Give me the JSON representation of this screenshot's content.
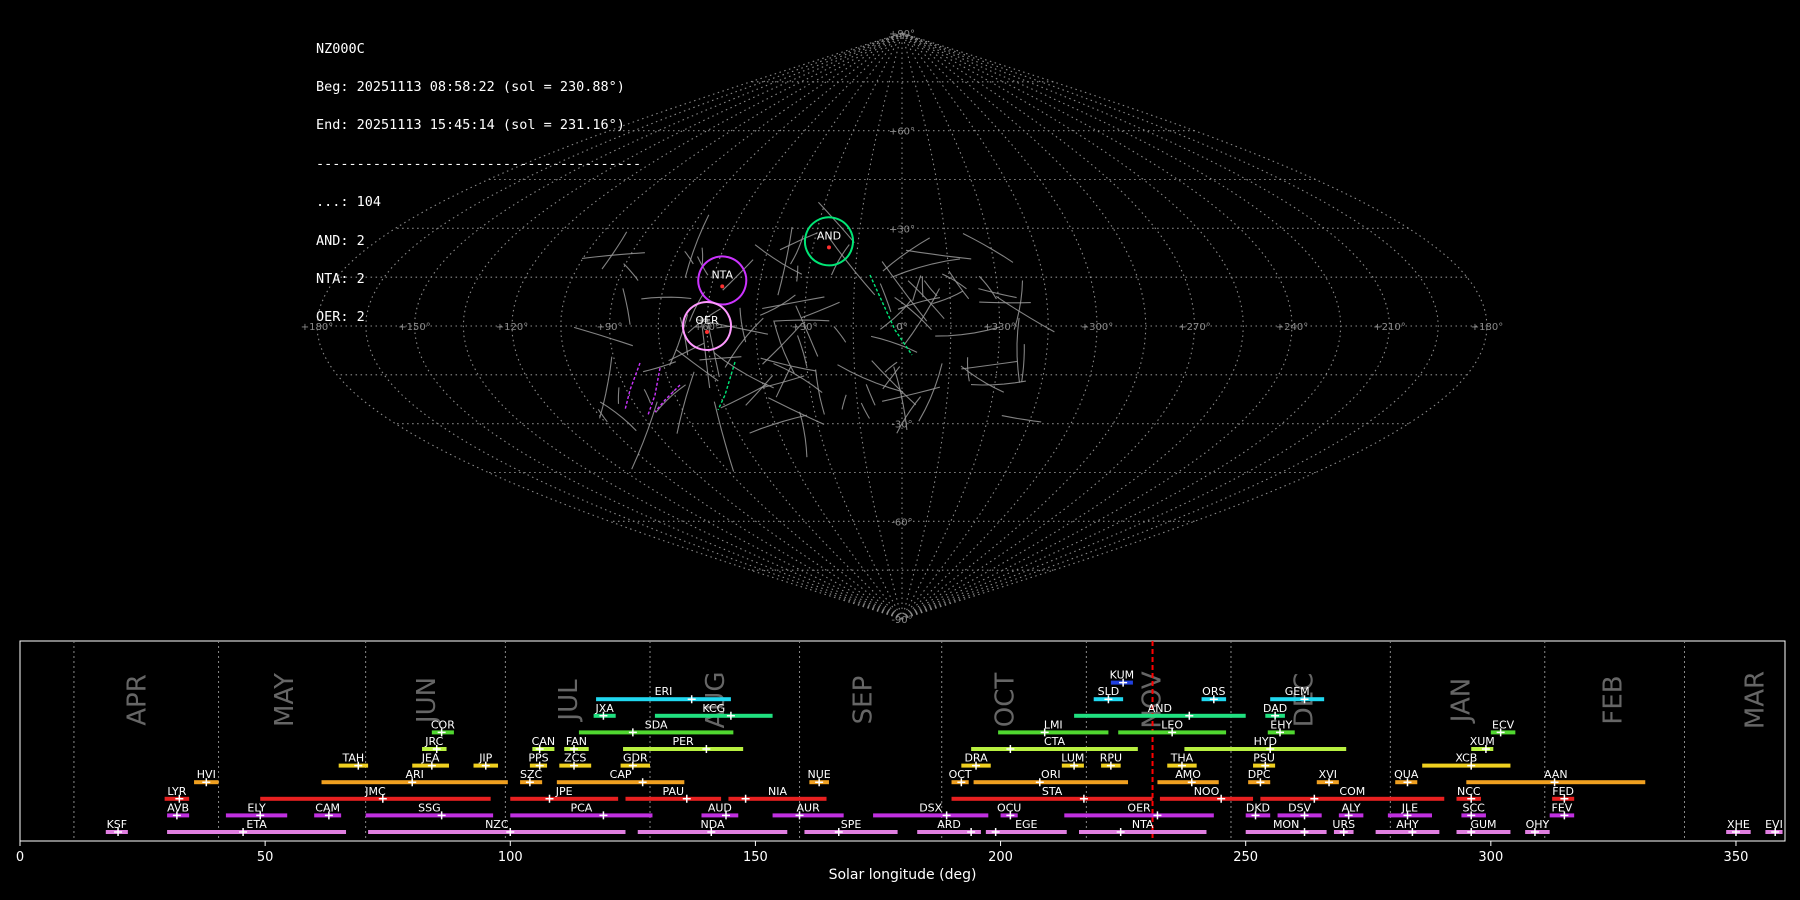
{
  "header": {
    "lines": [
      "NZ000C",
      "Beg: 20251113 08:58:22 (sol = 230.88°)",
      "End: 20251113 15:45:14 (sol = 231.16°)",
      "----------------------------------------",
      "...: 104",
      "AND: 2",
      "NTA: 2",
      "OER: 2"
    ]
  },
  "colors": {
    "background": "#000000",
    "grid": "#8a8a8a",
    "meteor": "#9a9a9a",
    "current_sol": "#ff0000"
  },
  "chart_data": [
    {
      "type": "scatter",
      "projection": "sinusoidal-sky",
      "lon_ticks": [
        "+180°",
        "+150°",
        "+120°",
        "+90°",
        "+60°",
        "+30°",
        "0°",
        "+330°",
        "+300°",
        "+270°",
        "+240°",
        "+210°",
        "+180°"
      ],
      "lat_ticks": [
        "+90°",
        "+60°",
        "+30°",
        "0°",
        "-30°",
        "-60°",
        "-90°"
      ],
      "radiants": [
        {
          "code": "NTA",
          "ra": 57,
          "dec": 14,
          "color": "#cc33ff"
        },
        {
          "code": "AND",
          "ra": 25,
          "dec": 26,
          "color": "#00e676"
        },
        {
          "code": "OER",
          "ra": 60,
          "dec": 0,
          "color": "#ff99ff"
        }
      ]
    },
    {
      "type": "bar",
      "xlabel": "Solar longitude (deg)",
      "xlim": [
        0,
        360
      ],
      "x_ticks": [
        0,
        50,
        100,
        150,
        200,
        250,
        300,
        350
      ],
      "current_sol": 231.0,
      "month_boundaries": [
        11,
        40.5,
        70.5,
        99,
        128.5,
        159,
        188,
        217.5,
        247,
        279.5,
        311,
        339.5
      ],
      "months": [
        {
          "label": "APR",
          "sol": 24
        },
        {
          "label": "MAY",
          "sol": 54
        },
        {
          "label": "JUN",
          "sol": 83
        },
        {
          "label": "JUL",
          "sol": 112
        },
        {
          "label": "AUG",
          "sol": 142
        },
        {
          "label": "SEP",
          "sol": 172
        },
        {
          "label": "OCT",
          "sol": 201
        },
        {
          "label": "NOV",
          "sol": 231
        },
        {
          "label": "DEC",
          "sol": 262
        },
        {
          "label": "JAN",
          "sol": 294
        },
        {
          "label": "FEB",
          "sol": 325
        },
        {
          "label": "MAR",
          "sol": 354
        }
      ],
      "showers": [
        {
          "code": "KSF",
          "start": 17.5,
          "end": 22,
          "peak": 20,
          "row": 0,
          "color": "#e07ee0"
        },
        {
          "code": "ETA",
          "start": 30,
          "end": 66.5,
          "peak": 45.5,
          "row": 0,
          "color": "#e07ee0"
        },
        {
          "code": "NZC",
          "start": 71,
          "end": 123.5,
          "peak": 100,
          "row": 0,
          "color": "#e07ee0"
        },
        {
          "code": "NDA",
          "start": 126,
          "end": 156.5,
          "peak": 141,
          "row": 0,
          "color": "#e07ee0"
        },
        {
          "code": "SPE",
          "start": 160,
          "end": 179,
          "peak": 167,
          "row": 0,
          "color": "#e07ee0"
        },
        {
          "code": "ARD",
          "start": 183,
          "end": 196,
          "peak": 194,
          "row": 0,
          "color": "#e07ee0"
        },
        {
          "code": "EGE",
          "start": 197,
          "end": 213.5,
          "peak": 199,
          "row": 0,
          "color": "#e07ee0"
        },
        {
          "code": "NTA",
          "start": 216,
          "end": 242,
          "peak": 224.5,
          "row": 0,
          "color": "#e07ee0"
        },
        {
          "code": "MON",
          "start": 250,
          "end": 266.5,
          "peak": 262,
          "row": 0,
          "color": "#e07ee0"
        },
        {
          "code": "URS",
          "start": 268,
          "end": 272,
          "peak": 270,
          "row": 0,
          "color": "#e07ee0"
        },
        {
          "code": "AHY",
          "start": 276.5,
          "end": 289.5,
          "peak": 284,
          "row": 0,
          "color": "#e07ee0"
        },
        {
          "code": "GUM",
          "start": 293,
          "end": 304,
          "peak": 296,
          "row": 0,
          "color": "#e07ee0"
        },
        {
          "code": "OHY",
          "start": 307,
          "end": 312,
          "peak": 309,
          "row": 0,
          "color": "#e07ee0"
        },
        {
          "code": "XHE",
          "start": 348,
          "end": 353,
          "peak": 350,
          "row": 0,
          "color": "#e07ee0"
        },
        {
          "code": "EVI",
          "start": 356,
          "end": 359.5,
          "peak": 358,
          "row": 0,
          "color": "#e07ee0"
        },
        {
          "code": "AVB",
          "start": 30,
          "end": 34.5,
          "peak": 32,
          "row": 1,
          "color": "#c030e0"
        },
        {
          "code": "ELY",
          "start": 42,
          "end": 54.5,
          "peak": 49,
          "row": 1,
          "color": "#c030e0"
        },
        {
          "code": "CAM",
          "start": 60,
          "end": 65.5,
          "peak": 63,
          "row": 1,
          "color": "#c030e0"
        },
        {
          "code": "SSG",
          "start": 70.5,
          "end": 96.5,
          "peak": 86,
          "row": 1,
          "color": "#c030e0"
        },
        {
          "code": "PCA",
          "start": 100,
          "end": 129,
          "peak": 119,
          "row": 1,
          "color": "#c030e0"
        },
        {
          "code": "AUD",
          "start": 139,
          "end": 146.5,
          "peak": 144,
          "row": 1,
          "color": "#c030e0"
        },
        {
          "code": "AUR",
          "start": 153.5,
          "end": 168,
          "peak": 159,
          "row": 1,
          "color": "#c030e0"
        },
        {
          "code": "DSX",
          "start": 174,
          "end": 197.5,
          "peak": 189,
          "row": 1,
          "color": "#c030e0"
        },
        {
          "code": "OCU",
          "start": 200,
          "end": 203.5,
          "peak": 202,
          "row": 1,
          "color": "#c030e0"
        },
        {
          "code": "OER",
          "start": 213,
          "end": 243.5,
          "peak": 232,
          "row": 1,
          "color": "#c030e0"
        },
        {
          "code": "DKD",
          "start": 250,
          "end": 255,
          "peak": 252,
          "row": 1,
          "color": "#c030e0"
        },
        {
          "code": "DSV",
          "start": 256.5,
          "end": 265.5,
          "peak": 262,
          "row": 1,
          "color": "#c030e0"
        },
        {
          "code": "ALY",
          "start": 269,
          "end": 274,
          "peak": 271,
          "row": 1,
          "color": "#c030e0"
        },
        {
          "code": "JLE",
          "start": 279,
          "end": 288,
          "peak": 283,
          "row": 1,
          "color": "#c030e0"
        },
        {
          "code": "SCC",
          "start": 294,
          "end": 299,
          "peak": 296,
          "row": 1,
          "color": "#c030e0"
        },
        {
          "code": "FEV",
          "start": 312,
          "end": 317,
          "peak": 315,
          "row": 1,
          "color": "#c030e0"
        },
        {
          "code": "LYR",
          "start": 29.5,
          "end": 34.5,
          "peak": 32.5,
          "row": 2,
          "color": "#e82020"
        },
        {
          "code": "JMC",
          "start": 49,
          "end": 96,
          "peak": 74,
          "row": 2,
          "color": "#e82020"
        },
        {
          "code": "JPE",
          "start": 100,
          "end": 122,
          "peak": 108,
          "row": 2,
          "color": "#e82020"
        },
        {
          "code": "PAU",
          "start": 123.5,
          "end": 143,
          "peak": 136,
          "row": 2,
          "color": "#e82020"
        },
        {
          "code": "NIA",
          "start": 144.5,
          "end": 164.5,
          "peak": 148,
          "row": 2,
          "color": "#e82020"
        },
        {
          "code": "STA",
          "start": 190,
          "end": 231,
          "peak": 217,
          "row": 2,
          "color": "#e82020"
        },
        {
          "code": "NOO",
          "start": 232.5,
          "end": 251.5,
          "peak": 245,
          "row": 2,
          "color": "#e82020"
        },
        {
          "code": "COM",
          "start": 253,
          "end": 290.5,
          "peak": 264,
          "row": 2,
          "color": "#e82020"
        },
        {
          "code": "NCC",
          "start": 293,
          "end": 298,
          "peak": 296,
          "row": 2,
          "color": "#e82020"
        },
        {
          "code": "FED",
          "start": 312.5,
          "end": 317,
          "peak": 315,
          "row": 2,
          "color": "#e82020"
        },
        {
          "code": "HVI",
          "start": 35.5,
          "end": 40.5,
          "peak": 38,
          "row": 3,
          "color": "#f0a020"
        },
        {
          "code": "ARI",
          "start": 61.5,
          "end": 99.5,
          "peak": 80,
          "row": 3,
          "color": "#f0a020"
        },
        {
          "code": "SZC",
          "start": 102,
          "end": 106.5,
          "peak": 104,
          "row": 3,
          "color": "#f0a020"
        },
        {
          "code": "CAP",
          "start": 109.5,
          "end": 135.5,
          "peak": 127,
          "row": 3,
          "color": "#f0a020"
        },
        {
          "code": "NUE",
          "start": 161,
          "end": 165,
          "peak": 163,
          "row": 3,
          "color": "#f0a020"
        },
        {
          "code": "OCT",
          "start": 190,
          "end": 193.5,
          "peak": 192,
          "row": 3,
          "color": "#f0a020"
        },
        {
          "code": "ORI",
          "start": 194.5,
          "end": 226,
          "peak": 208,
          "row": 3,
          "color": "#f0a020"
        },
        {
          "code": "AMO",
          "start": 232,
          "end": 244.5,
          "peak": 239,
          "row": 3,
          "color": "#f0a020"
        },
        {
          "code": "DPC",
          "start": 250.5,
          "end": 255,
          "peak": 253,
          "row": 3,
          "color": "#f0a020"
        },
        {
          "code": "XVI",
          "start": 264.5,
          "end": 269,
          "peak": 267,
          "row": 3,
          "color": "#f0a020"
        },
        {
          "code": "QUA",
          "start": 280.5,
          "end": 285,
          "peak": 283,
          "row": 3,
          "color": "#f0a020"
        },
        {
          "code": "AAN",
          "start": 295,
          "end": 331.5,
          "peak": 313,
          "row": 3,
          "color": "#f0a020"
        },
        {
          "code": "TAH",
          "start": 65,
          "end": 71,
          "peak": 69,
          "row": 4,
          "color": "#f0d020"
        },
        {
          "code": "JEA",
          "start": 80,
          "end": 87.5,
          "peak": 84,
          "row": 4,
          "color": "#f0d020"
        },
        {
          "code": "JIP",
          "start": 92.5,
          "end": 97.5,
          "peak": 95,
          "row": 4,
          "color": "#f0d020"
        },
        {
          "code": "PPS",
          "start": 104,
          "end": 107.5,
          "peak": 106,
          "row": 4,
          "color": "#f0d020"
        },
        {
          "code": "ZCS",
          "start": 110,
          "end": 116.5,
          "peak": 113,
          "row": 4,
          "color": "#f0d020"
        },
        {
          "code": "GDR",
          "start": 122.5,
          "end": 128.5,
          "peak": 125,
          "row": 4,
          "color": "#f0d020"
        },
        {
          "code": "DRA",
          "start": 192,
          "end": 198,
          "peak": 195,
          "row": 4,
          "color": "#f0d020"
        },
        {
          "code": "LUM",
          "start": 212.5,
          "end": 217,
          "peak": 215,
          "row": 4,
          "color": "#f0d020"
        },
        {
          "code": "RPU",
          "start": 220.5,
          "end": 224.5,
          "peak": 222.5,
          "row": 4,
          "color": "#f0d020"
        },
        {
          "code": "THA",
          "start": 234,
          "end": 240,
          "peak": 237,
          "row": 4,
          "color": "#f0d020"
        },
        {
          "code": "PSU",
          "start": 251.5,
          "end": 256,
          "peak": 254,
          "row": 4,
          "color": "#f0d020"
        },
        {
          "code": "XCB",
          "start": 286,
          "end": 304,
          "peak": 296,
          "row": 4,
          "color": "#f0d020"
        },
        {
          "code": "JRC",
          "start": 82,
          "end": 87,
          "peak": 85,
          "row": 5,
          "color": "#b8f040"
        },
        {
          "code": "CAN",
          "start": 104.5,
          "end": 109,
          "peak": 106,
          "row": 5,
          "color": "#b8f040"
        },
        {
          "code": "FAN",
          "start": 111,
          "end": 116,
          "peak": 113,
          "row": 5,
          "color": "#b8f040"
        },
        {
          "code": "PER",
          "start": 123,
          "end": 147.5,
          "peak": 140,
          "row": 5,
          "color": "#b8f040"
        },
        {
          "code": "CTA",
          "start": 194,
          "end": 228,
          "peak": 202,
          "row": 5,
          "color": "#b8f040"
        },
        {
          "code": "HYD",
          "start": 237.5,
          "end": 270.5,
          "peak": 255,
          "row": 5,
          "color": "#b8f040"
        },
        {
          "code": "XUM",
          "start": 296,
          "end": 300.5,
          "peak": 299,
          "row": 5,
          "color": "#b8f040"
        },
        {
          "code": "COR",
          "start": 84,
          "end": 88.5,
          "peak": 86,
          "row": 6,
          "color": "#50d830"
        },
        {
          "code": "SDA",
          "start": 114,
          "end": 145.5,
          "peak": 125,
          "row": 6,
          "color": "#50d830"
        },
        {
          "code": "LMI",
          "start": 199.5,
          "end": 222,
          "peak": 209,
          "row": 6,
          "color": "#50d830"
        },
        {
          "code": "LEO",
          "start": 224,
          "end": 246,
          "peak": 235,
          "row": 6,
          "color": "#50d830"
        },
        {
          "code": "EHY",
          "start": 254.5,
          "end": 260,
          "peak": 257,
          "row": 6,
          "color": "#50d830"
        },
        {
          "code": "ECV",
          "start": 300,
          "end": 305,
          "peak": 302,
          "row": 6,
          "color": "#50d830"
        },
        {
          "code": "JXA",
          "start": 117,
          "end": 121.5,
          "peak": 119,
          "row": 7,
          "color": "#20e080"
        },
        {
          "code": "KCG",
          "start": 129.5,
          "end": 153.5,
          "peak": 145,
          "row": 7,
          "color": "#20e080"
        },
        {
          "code": "AND",
          "start": 215,
          "end": 250,
          "peak": 238.5,
          "row": 7,
          "color": "#20e080"
        },
        {
          "code": "DAD",
          "start": 254,
          "end": 258,
          "peak": 256,
          "row": 7,
          "color": "#20e080"
        },
        {
          "code": "ERI",
          "start": 117.5,
          "end": 145,
          "peak": 137,
          "row": 8,
          "color": "#20d8f0"
        },
        {
          "code": "SLD",
          "start": 219,
          "end": 225,
          "peak": 222,
          "row": 8,
          "color": "#20d8f0"
        },
        {
          "code": "ORS",
          "start": 241,
          "end": 246,
          "peak": 243.5,
          "row": 8,
          "color": "#20d8f0"
        },
        {
          "code": "GEM",
          "start": 255,
          "end": 266,
          "peak": 262,
          "row": 8,
          "color": "#20d8f0"
        },
        {
          "code": "KUM",
          "start": 222.5,
          "end": 227,
          "peak": 225,
          "row": 9,
          "color": "#2040e0"
        }
      ]
    }
  ]
}
